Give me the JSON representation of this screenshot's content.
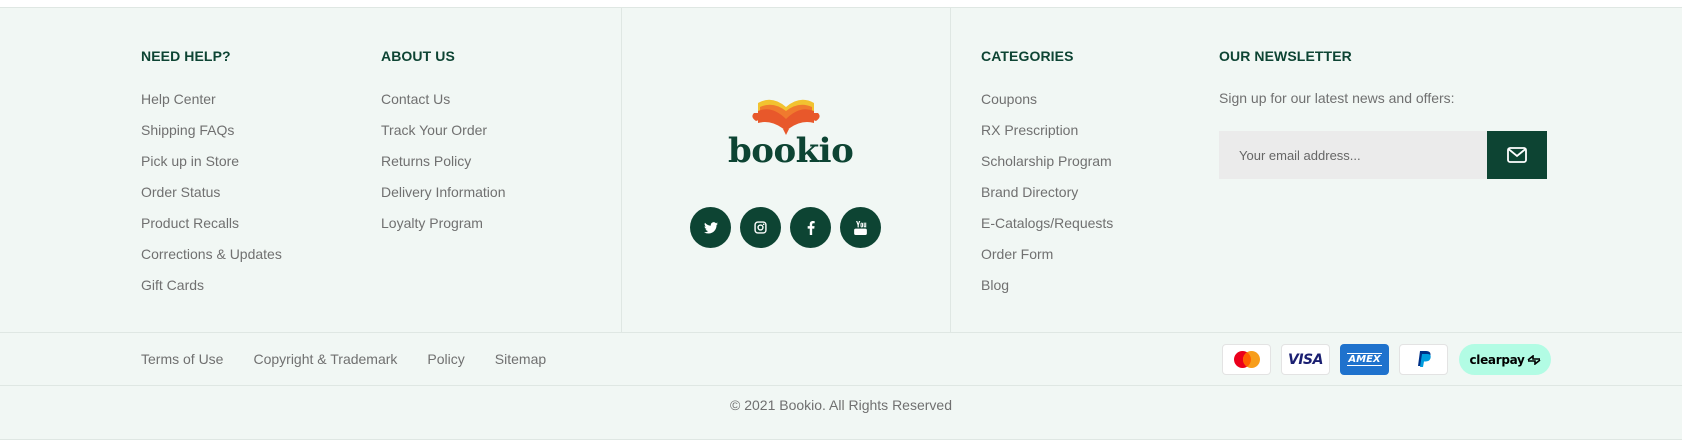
{
  "columns": {
    "help": {
      "title": "NEED HELP?",
      "links": [
        "Help Center",
        "Shipping FAQs",
        "Pick up in Store",
        "Order Status",
        "Product Recalls",
        "Corrections & Updates",
        "Gift Cards"
      ]
    },
    "about": {
      "title": "ABOUT US",
      "links": [
        "Contact Us",
        "Track Your Order",
        "Returns Policy",
        "Delivery Information",
        "Loyalty Program"
      ]
    },
    "categories": {
      "title": "CATEGORIES",
      "links": [
        "Coupons",
        "RX Prescription",
        "Scholarship Program",
        "Brand Directory",
        "E-Catalogs/Requests",
        "Order Form",
        "Blog"
      ]
    }
  },
  "brand": {
    "name": "bookio"
  },
  "socials": [
    {
      "icon": "twitter-icon"
    },
    {
      "icon": "instagram-icon"
    },
    {
      "icon": "facebook-icon"
    },
    {
      "icon": "youtube-icon"
    }
  ],
  "newsletter": {
    "title": "OUR NEWSLETTER",
    "text": "Sign up for our latest news and offers:",
    "placeholder": "Your email address...",
    "button_icon": "envelope-icon"
  },
  "bottom_links": [
    "Terms of Use",
    "Copyright & Trademark",
    "Policy",
    "Sitemap"
  ],
  "payments": {
    "mastercard": "mastercard",
    "visa": "VISA",
    "amex": "AMEX",
    "paypal": "paypal",
    "clearpay": "clearpay"
  },
  "copyright": "© 2021 Bookio. All Rights Reserved",
  "colors": {
    "brand_green": "#0d4433",
    "background": "#f1f7f4",
    "clearpay_mint": "#b2fce4"
  }
}
